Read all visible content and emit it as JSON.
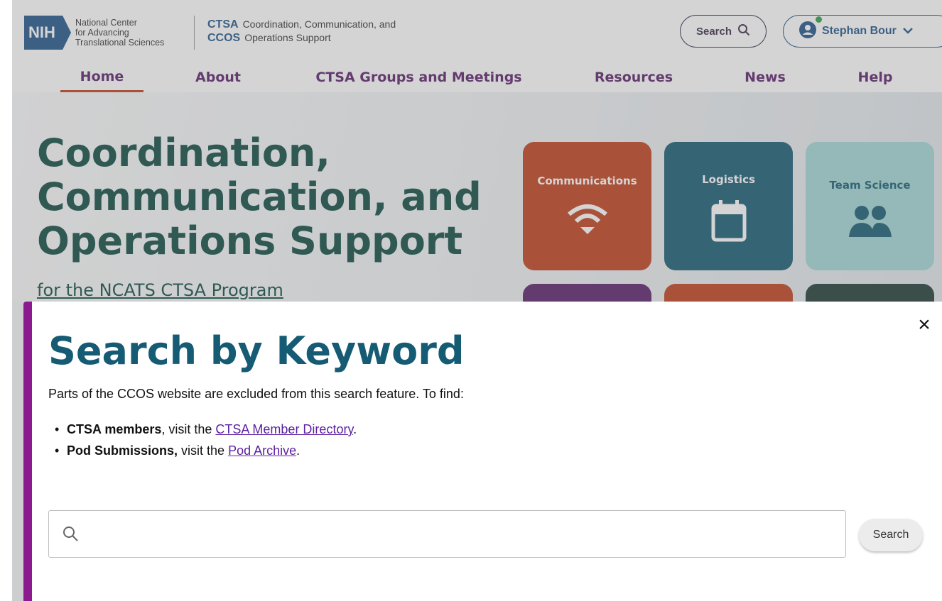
{
  "header": {
    "nih_logo_text": "NIH",
    "nih_line1": "National Center",
    "nih_line2": "for Advancing",
    "nih_line3": "Translational Sciences",
    "ctsa_abbr": "CTSA",
    "ccos_abbr": "CCOS",
    "ctsa_line1": "Coordination, Communication, and",
    "ctsa_line2": "Operations Support",
    "search_label": "Search",
    "user_name": "Stephan Bour"
  },
  "nav": {
    "items": [
      {
        "label": "Home",
        "active": true
      },
      {
        "label": "About"
      },
      {
        "label": "CTSA Groups and Meetings"
      },
      {
        "label": "Resources"
      },
      {
        "label": "News"
      },
      {
        "label": "Help"
      }
    ]
  },
  "hero": {
    "title_line1": "Coordination,",
    "title_line2": "Communication, and",
    "title_line3": "Operations Support",
    "subtitle": "for the NCATS CTSA Program",
    "tiles": [
      {
        "label": "Communications",
        "icon": "wifi-icon",
        "color": "#c0401b"
      },
      {
        "label": "Logistics",
        "icon": "calendar-icon",
        "color": "#155b73"
      },
      {
        "label": "Team Science",
        "icon": "people-icon",
        "color": "#a3d8d8"
      }
    ],
    "tile_row2_colors": [
      "#5a1e6b",
      "#c0401b",
      "#1e3a34"
    ]
  },
  "modal": {
    "title": "Search by Keyword",
    "description": "Parts of the CCOS website are excluded from this search feature. To find:",
    "items": [
      {
        "bold": "CTSA members",
        "text_before": ", visit the ",
        "link": "CTSA Member Directory",
        "text_after": "."
      },
      {
        "bold": "Pod Submissions,",
        "text_before": " visit the ",
        "link": "Pod Archive",
        "text_after": "."
      }
    ],
    "search_input_value": "",
    "search_button_label": "Search",
    "close_label": "×"
  },
  "colors": {
    "accent_purple": "#8b1a8f",
    "title_teal": "#155b73",
    "link_purple": "#5b1fa0"
  }
}
